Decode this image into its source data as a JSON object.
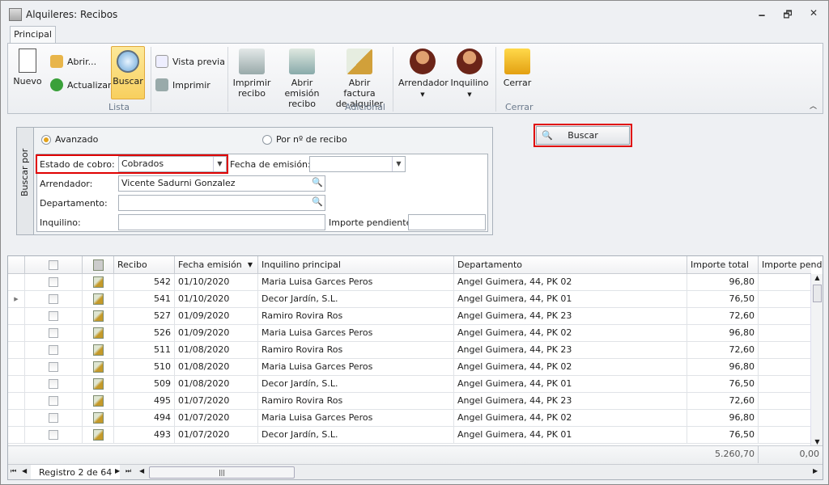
{
  "window": {
    "title": "Alquileres: Recibos",
    "minimize": "🗕",
    "restore": "🗗",
    "close": "✕"
  },
  "ribbon": {
    "tab": "Principal",
    "nuevo": "Nuevo",
    "abrir": "Abrir...",
    "actualizar": "Actualizar",
    "buscar": "Buscar",
    "vista_previa": "Vista previa",
    "imprimir": "Imprimir",
    "imprimir_recibo": [
      "Imprimir",
      "recibo"
    ],
    "abrir_emision": [
      "Abrir emisión",
      "recibo"
    ],
    "abrir_factura": [
      "Abrir factura",
      "de alquiler"
    ],
    "arrendador": "Arrendador",
    "inquilino": "Inquilino",
    "cerrar": "Cerrar",
    "groups": {
      "lista": "Lista",
      "adicional": "Adicional",
      "cerrar": "Cerrar"
    }
  },
  "search": {
    "side_label": "Buscar por",
    "radio_avanzado": "Avanzado",
    "radio_recibo": "Por nº de recibo",
    "estado_label": "Estado de cobro:",
    "estado_value": "Cobrados",
    "fecha_label": "Fecha de emisión:",
    "fecha_value": "",
    "arrendador_label": "Arrendador:",
    "arrendador_value": "Vicente Sadurni Gonzalez",
    "departamento_label": "Departamento:",
    "departamento_value": "",
    "inquilino_label": "Inquilino:",
    "inquilino_value": "",
    "importe_label": "Importe pendiente:",
    "importe_value": "",
    "buscar_button": "Buscar"
  },
  "grid": {
    "columns": [
      "Recibo",
      "Fecha emisión",
      "Inquilino principal",
      "Departamento",
      "Importe total",
      "Importe pendiente"
    ],
    "rows": [
      [
        "542",
        "01/10/2020",
        "Maria Luisa Garces Peros",
        "Angel Guimera, 44, PK 02",
        "96,80",
        ""
      ],
      [
        "541",
        "01/10/2020",
        "Decor Jardín, S.L.",
        "Angel Guimera, 44, PK 01",
        "76,50",
        ""
      ],
      [
        "527",
        "01/09/2020",
        "Ramiro Rovira Ros",
        "Angel Guimera, 44, PK 23",
        "72,60",
        ""
      ],
      [
        "526",
        "01/09/2020",
        "Maria Luisa Garces Peros",
        "Angel Guimera, 44, PK 02",
        "96,80",
        ""
      ],
      [
        "511",
        "01/08/2020",
        "Ramiro Rovira Ros",
        "Angel Guimera, 44, PK 23",
        "72,60",
        ""
      ],
      [
        "510",
        "01/08/2020",
        "Maria Luisa Garces Peros",
        "Angel Guimera, 44, PK 02",
        "96,80",
        ""
      ],
      [
        "509",
        "01/08/2020",
        "Decor Jardín, S.L.",
        "Angel Guimera, 44, PK 01",
        "76,50",
        ""
      ],
      [
        "495",
        "01/07/2020",
        "Ramiro Rovira Ros",
        "Angel Guimera, 44, PK 23",
        "72,60",
        ""
      ],
      [
        "494",
        "01/07/2020",
        "Maria Luisa Garces Peros",
        "Angel Guimera, 44, PK 02",
        "96,80",
        ""
      ],
      [
        "493",
        "01/07/2020",
        "Decor Jardín, S.L.",
        "Angel Guimera, 44, PK 01",
        "76,50",
        ""
      ]
    ],
    "current_row": 1,
    "totals": {
      "importe_total": "5.260,70",
      "importe_pendiente": "0,00"
    },
    "navigator": "Registro 2 de 64"
  }
}
